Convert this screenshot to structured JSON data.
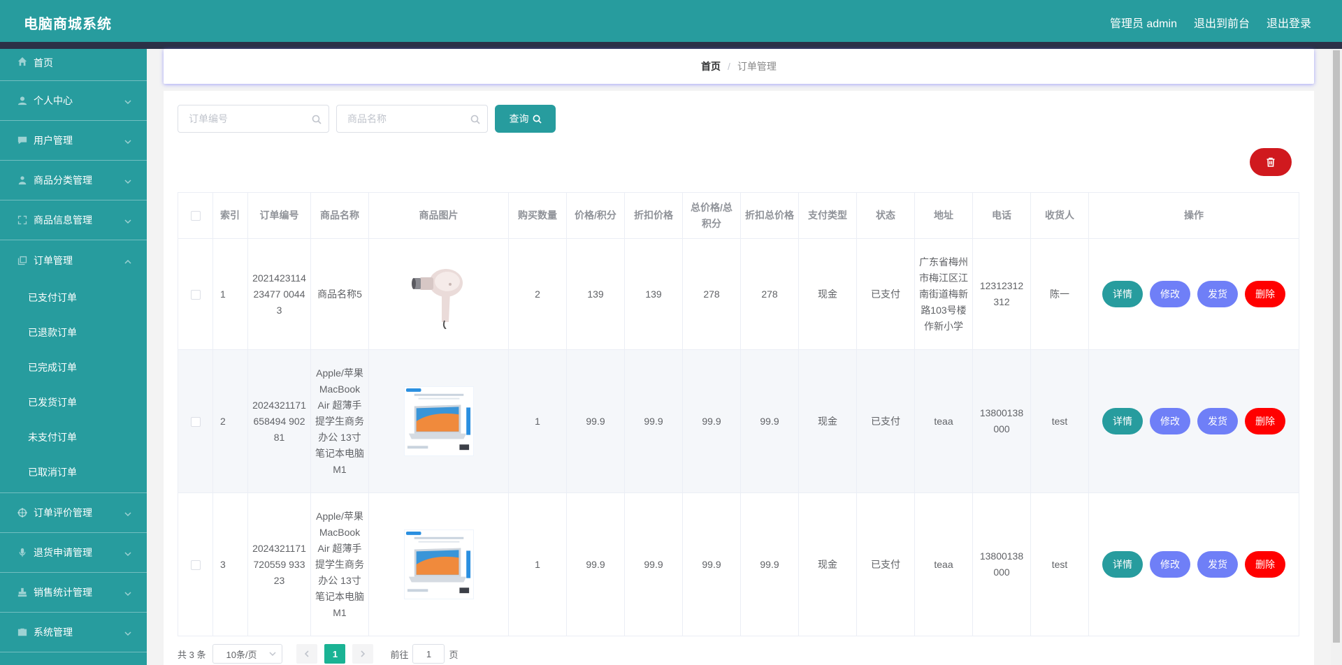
{
  "header": {
    "title": "电脑商城系统",
    "admin_label": "管理员 admin",
    "front_label": "退出到前台",
    "logout_label": "退出登录"
  },
  "sidebar": {
    "items": [
      {
        "label": "首页",
        "icon": "home-icon"
      },
      {
        "label": "个人中心",
        "icon": "user-icon"
      },
      {
        "label": "用户管理",
        "icon": "chat-icon"
      },
      {
        "label": "商品分类管理",
        "icon": "person-icon"
      },
      {
        "label": "商品信息管理",
        "icon": "fullscreen-icon"
      },
      {
        "label": "订单管理",
        "icon": "copy-icon"
      },
      {
        "label": "订单评价管理",
        "icon": "target-icon"
      },
      {
        "label": "退货申请管理",
        "icon": "microphone-icon"
      },
      {
        "label": "销售统计管理",
        "icon": "stamp-icon"
      },
      {
        "label": "系统管理",
        "icon": "briefcase-icon"
      }
    ],
    "order_sub": [
      "已支付订单",
      "已退款订单",
      "已完成订单",
      "已发货订单",
      "未支付订单",
      "已取消订单"
    ]
  },
  "breadcrumb": {
    "home": "首页",
    "separator": "/",
    "current": "订单管理"
  },
  "search": {
    "order_no_placeholder": "订单编号",
    "product_name_placeholder": "商品名称",
    "query_label": "查询"
  },
  "table": {
    "headers": [
      "索引",
      "订单编号",
      "商品名称",
      "商品图片",
      "购买数量",
      "价格/积分",
      "折扣价格",
      "总价格/总积分",
      "折扣总价格",
      "支付类型",
      "状态",
      "地址",
      "电话",
      "收货人",
      "操作"
    ],
    "rows": [
      {
        "index": "1",
        "order_no": "202142311423477 00443",
        "product": "商品名称5",
        "image": "hair-dryer-image",
        "qty": "2",
        "price": "139",
        "discount_price": "139",
        "total": "278",
        "discount_total": "278",
        "pay_type": "现金",
        "status": "已支付",
        "address": "广东省梅州市梅江区江南街道梅新路103号楼作新小学",
        "phone": "12312312312",
        "receiver": "陈一"
      },
      {
        "index": "2",
        "order_no": "2024321171658494 90281",
        "product": "Apple/苹果 MacBook Air 超薄手提学生商务办公 13寸笔记本电脑M1",
        "image": "laptop-image",
        "qty": "1",
        "price": "99.9",
        "discount_price": "99.9",
        "total": "99.9",
        "discount_total": "99.9",
        "pay_type": "现金",
        "status": "已支付",
        "address": "teaa",
        "phone": "13800138000",
        "receiver": "test"
      },
      {
        "index": "3",
        "order_no": "2024321171720559 93323",
        "product": "Apple/苹果 MacBook Air 超薄手提学生商务办公 13寸笔记本电脑M1",
        "image": "laptop-image",
        "qty": "1",
        "price": "99.9",
        "discount_price": "99.9",
        "total": "99.9",
        "discount_total": "99.9",
        "pay_type": "现金",
        "status": "已支付",
        "address": "teaa",
        "phone": "13800138000",
        "receiver": "test"
      }
    ],
    "actions": {
      "detail": "详情",
      "edit": "修改",
      "ship": "发货",
      "delete": "删除"
    }
  },
  "pagination": {
    "total": "共 3 条",
    "page_size": "10条/页",
    "current_page": "1",
    "goto_prefix": "前往",
    "goto_value": "1",
    "goto_suffix": "页"
  },
  "colors": {
    "primary": "#279c9e",
    "dark_bar": "#2c3147",
    "edit": "#6f7ff7",
    "delete": "#ff0000",
    "batch_delete": "#d0191e",
    "page_active": "#1ab394"
  }
}
